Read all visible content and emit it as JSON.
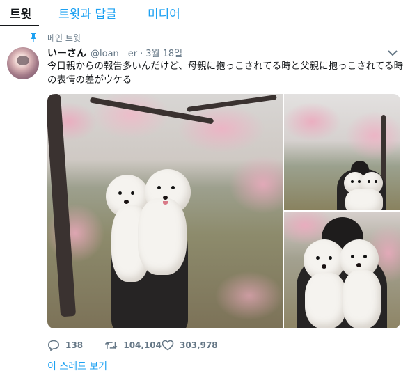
{
  "tabs": [
    {
      "label": "트윗"
    },
    {
      "label": "트윗과 답글"
    },
    {
      "label": "미디어"
    }
  ],
  "pinned_label": "메인 트윗",
  "tweet": {
    "name": "いーさん",
    "handle": "@loan__er",
    "separator": "·",
    "date": "3월 18일",
    "text": "今日親からの報告多いんだけど、母親に抱っこされてる時と父親に抱っこされてる時の表情の差がウケる"
  },
  "media": {
    "photos": [
      "main-photo",
      "top-right-photo",
      "bottom-right-photo"
    ]
  },
  "actions": {
    "replies": "138",
    "retweets": "104,104",
    "likes": "303,978"
  },
  "thread_link": "이 스레드 보기",
  "colors": {
    "accent": "#1da1f2",
    "muted": "#657786",
    "text": "#14171a"
  },
  "icons": [
    "pin-icon",
    "chevron-down-icon",
    "reply-icon",
    "retweet-icon",
    "like-icon"
  ]
}
